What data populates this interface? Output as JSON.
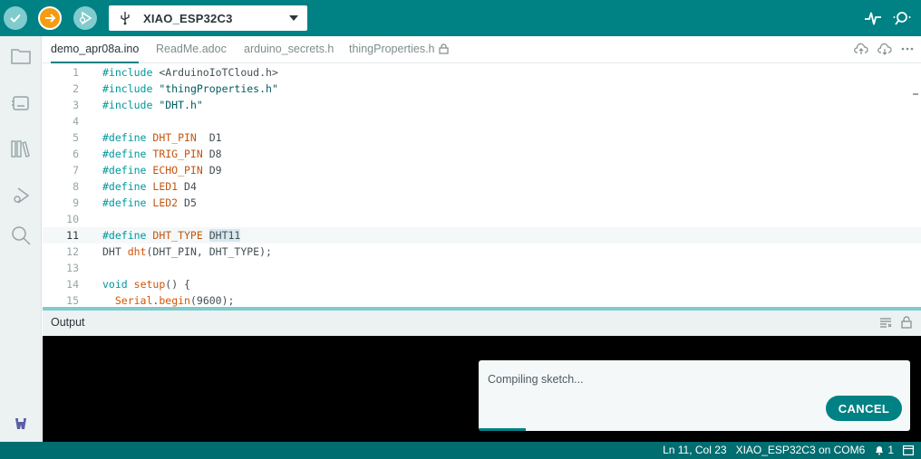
{
  "toolbar": {
    "verify_icon": "check-icon",
    "upload_icon": "arrow-right-icon",
    "debug_icon": "debug-icon",
    "board_name": "XIAO_ESP32C3",
    "plotter_icon": "serial-plotter-icon",
    "monitor_icon": "serial-monitor-icon"
  },
  "rail": {
    "items": [
      "sketchbook-icon",
      "boards-manager-icon",
      "library-manager-icon",
      "debug-icon",
      "search-icon"
    ],
    "bottom_icon": "arduino-cloud-icon"
  },
  "tabs": [
    {
      "label": "demo_apr08a.ino",
      "active": true
    },
    {
      "label": "ReadMe.adoc"
    },
    {
      "label": "arduino_secrets.h"
    },
    {
      "label": "thingProperties.h",
      "locked": true
    }
  ],
  "editor": {
    "current_line": 11,
    "lines": [
      {
        "n": "1",
        "text": "#include <ArduinoIoTCloud.h>"
      },
      {
        "n": "2",
        "text": "#include \"thingProperties.h\""
      },
      {
        "n": "3",
        "text": "#include \"DHT.h\""
      },
      {
        "n": "4",
        "text": ""
      },
      {
        "n": "5",
        "text": "#define DHT_PIN  D1"
      },
      {
        "n": "6",
        "text": "#define TRIG_PIN D8"
      },
      {
        "n": "7",
        "text": "#define ECHO_PIN D9"
      },
      {
        "n": "8",
        "text": "#define LED1 D4"
      },
      {
        "n": "9",
        "text": "#define LED2 D5"
      },
      {
        "n": "10",
        "text": ""
      },
      {
        "n": "11",
        "text": "#define DHT_TYPE DHT11"
      },
      {
        "n": "12",
        "text": "DHT dht(DHT_PIN, DHT_TYPE);"
      },
      {
        "n": "13",
        "text": ""
      },
      {
        "n": "14",
        "text": "void setup() {"
      },
      {
        "n": "15",
        "text": "  Serial.begin(9600);"
      }
    ]
  },
  "output": {
    "title": "Output"
  },
  "notification": {
    "message": "Compiling sketch...",
    "cancel_label": "CANCEL",
    "progress": 0.11
  },
  "status": {
    "cursor": "Ln 11, Col 23",
    "board_port": "XIAO_ESP32C3 on COM6",
    "notification_count": "1"
  },
  "colors": {
    "toolbar": "#008184",
    "statusbar": "#006d70",
    "accent": "#008184",
    "upload_button": "#f39c12"
  }
}
